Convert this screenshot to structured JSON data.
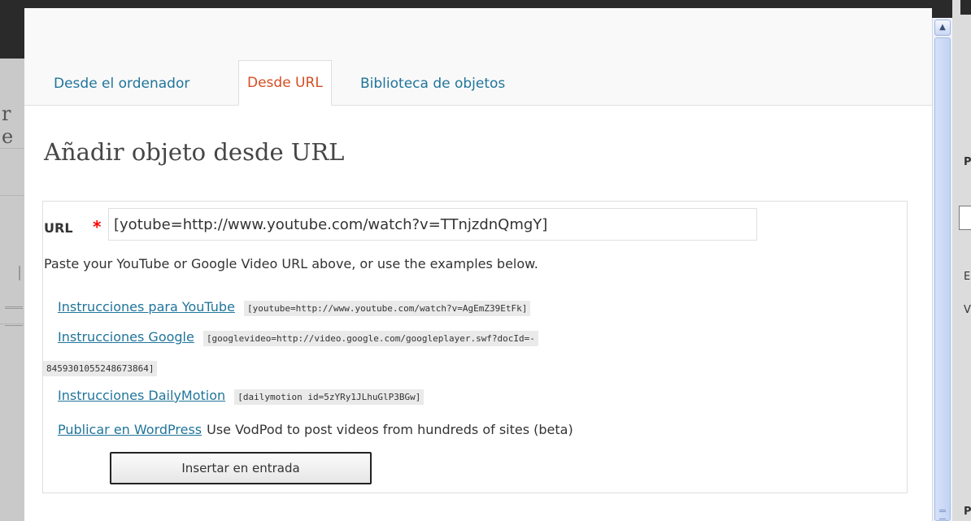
{
  "tabs": [
    {
      "label": "Desde el ordenador"
    },
    {
      "label": "Desde URL"
    },
    {
      "label": "Biblioteca de objetos"
    }
  ],
  "heading": "Añadir objeto desde URL",
  "form": {
    "url_label": "URL",
    "required_mark": "*",
    "url_value": "[yotube=http://www.youtube.com/watch?v=TTnjzdnQmgY]",
    "help_text": "Paste your YouTube or Google Video URL above, or use the examples below."
  },
  "examples": [
    {
      "link": "Instrucciones para YouTube",
      "code": "[youtube=http://www.youtube.com/watch?v=AgEmZ39EtFk]"
    },
    {
      "link": "Instrucciones Google",
      "code_line1": "[googlevideo=http://video.google.com/googleplayer.swf?docId=-",
      "code_line2": "8459301055248673864]"
    },
    {
      "link": "Instrucciones DailyMotion",
      "code": "[dailymotion id=5zYRy1JLhuGlP3BGw]"
    },
    {
      "link": "Publicar en WordPress",
      "text": "Use VodPod to post videos from hundreds of sites (beta)"
    }
  ],
  "insert_button": "Insertar en entrada",
  "scrollbar": {
    "up_arrow": "▲"
  },
  "background": {
    "left_fragment": "r e",
    "right_fragments": [
      "P",
      "E",
      "V",
      "P"
    ]
  },
  "colors": {
    "link": "#21759b",
    "active_tab": "#d54e21",
    "required": "#ff0000"
  }
}
